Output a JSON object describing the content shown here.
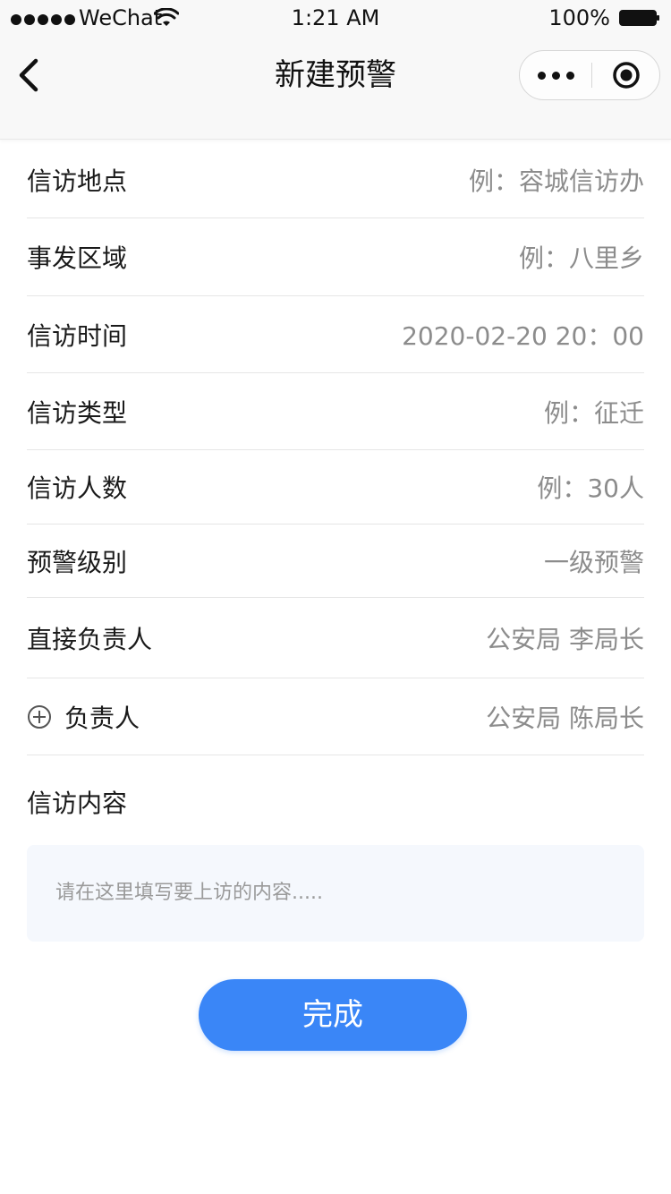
{
  "status_bar": {
    "carrier": "WeChat",
    "time": "1:21 AM",
    "battery": "100%"
  },
  "nav": {
    "title": "新建预警"
  },
  "form": {
    "rows": [
      {
        "label": "信访地点",
        "value": "例：容城信访办"
      },
      {
        "label": "事发区域",
        "value": "例：八里乡"
      },
      {
        "label": "信访时间",
        "value": "2020-02-20 20：00"
      },
      {
        "label": "信访类型",
        "value": "例：征迁"
      },
      {
        "label": "信访人数",
        "value": "例：30人"
      },
      {
        "label": "预警级别",
        "value": "一级预警"
      },
      {
        "label": "直接负责人",
        "value": "公安局 李局长"
      },
      {
        "label": "负责人",
        "value": "公安局 陈局长",
        "icon": "plus-circle-icon"
      }
    ],
    "content_label": "信访内容",
    "content_placeholder": "请在这里填写要上访的内容....."
  },
  "submit_label": "完成",
  "colors": {
    "accent": "#3a86f7",
    "value_text": "#8c8c8c",
    "textarea_bg": "#f5f8fd"
  }
}
